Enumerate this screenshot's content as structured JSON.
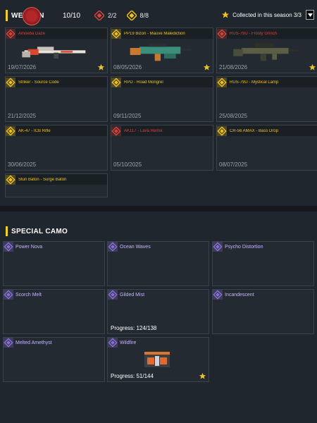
{
  "header": {
    "title": "WEAPON",
    "count": "10/10",
    "stat_red": "2/2",
    "stat_gold": "8/8",
    "season": "Collected in this season 3/3"
  },
  "weapons": [
    {
      "name": "Amoeba Daze",
      "date": "19/07/2026",
      "tier": "red",
      "starred": true,
      "image": "sniper-rifle"
    },
    {
      "name": "PP19 Bizon - Mauve Malediction",
      "date": "08/05/2026",
      "tier": "gold",
      "starred": true,
      "image": "smg"
    },
    {
      "name": "RUS-79U - Frosty Grinch",
      "date": "21/08/2026",
      "tier": "red",
      "starred": true,
      "image": "rifle"
    },
    {
      "name": "Striker - Source Code",
      "date": "21/12/2025",
      "tier": "gold",
      "starred": false,
      "image": ""
    },
    {
      "name": "RPD - Road Mongrel",
      "date": "09/11/2025",
      "tier": "gold",
      "starred": false,
      "image": ""
    },
    {
      "name": "RUS-79U - Mystical Lamp",
      "date": "25/08/2025",
      "tier": "gold",
      "starred": false,
      "image": ""
    },
    {
      "name": "AK-47 - ICB Rifle",
      "date": "30/06/2025",
      "tier": "gold",
      "starred": false,
      "image": ""
    },
    {
      "name": "AK117 - Lava Remix",
      "date": "05/10/2025",
      "tier": "red",
      "starred": false,
      "image": ""
    },
    {
      "name": "CR-56 AMAX - Bass Drop",
      "date": "08/07/2025",
      "tier": "gold",
      "starred": false,
      "image": ""
    },
    {
      "name": "Stun Baton - Surge Baton",
      "date": "",
      "tier": "gold",
      "starred": false,
      "image": ""
    }
  ],
  "camo": {
    "title": "SPECIAL CAMO",
    "items": [
      {
        "name": "Power Nova",
        "progress": "",
        "starred": false,
        "image": ""
      },
      {
        "name": "Ocean Waves",
        "progress": "",
        "starred": false,
        "image": ""
      },
      {
        "name": "Psycho Distortion",
        "progress": "",
        "starred": false,
        "image": ""
      },
      {
        "name": "Scorch Melt",
        "progress": "",
        "starred": false,
        "image": ""
      },
      {
        "name": "Gilded Mist",
        "progress": "Progress: 124/138",
        "starred": false,
        "image": ""
      },
      {
        "name": "Incandescent",
        "progress": "",
        "starred": false,
        "image": ""
      },
      {
        "name": "Melted Amethyst",
        "progress": "",
        "starred": false,
        "image": ""
      },
      {
        "name": "Wildfire",
        "progress": "Progress: 51/144",
        "starred": true,
        "image": "crate"
      }
    ]
  },
  "colors": {
    "gold": "#f2c21d",
    "red_tier": "#d8443b",
    "purple": "#8a6fd6",
    "accent": "#f2d21d"
  }
}
